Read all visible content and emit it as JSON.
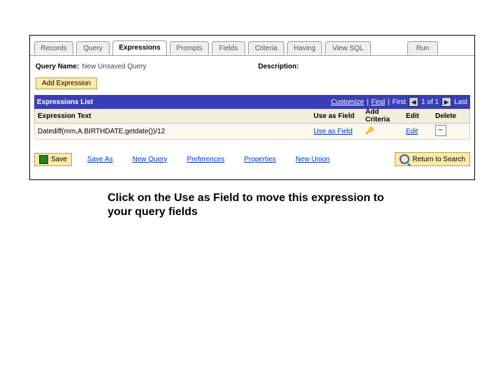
{
  "tabs": {
    "records": "Records",
    "query": "Query",
    "expressions": "Expressions",
    "prompts": "Prompts",
    "fields": "Fields",
    "criteria": "Criteria",
    "having": "Having",
    "viewsql": "View SQL",
    "run": "Run"
  },
  "queryNameLabel": "Query Name:",
  "queryNameValue": "New Unsaved Query",
  "descriptionLabel": "Description:",
  "addExpression": "Add Expression",
  "listTitle": "Expressions List",
  "listCtrl": {
    "customize": "Customize",
    "find": "Find",
    "count": "1 of 1",
    "first": "First",
    "last": "Last",
    "firstSym": "◀",
    "lastSym": "▶"
  },
  "cols": {
    "expr": "Expression Text",
    "use": "Use as Field",
    "crit": "Add Criteria",
    "edit": "Edit",
    "del": "Delete"
  },
  "row": {
    "expr": "Datediff(mm,A.BIRTHDATE,getdate())/12",
    "use": "Use as Field",
    "edit": "Edit"
  },
  "actions": {
    "save": "Save",
    "saveas": "Save As",
    "newq": "New Query",
    "prefs": "Preferences",
    "props": "Properties",
    "newu": "New Union",
    "ret": "Return to Search"
  },
  "caption": "Click on the Use as Field to move this expression to your query fields"
}
